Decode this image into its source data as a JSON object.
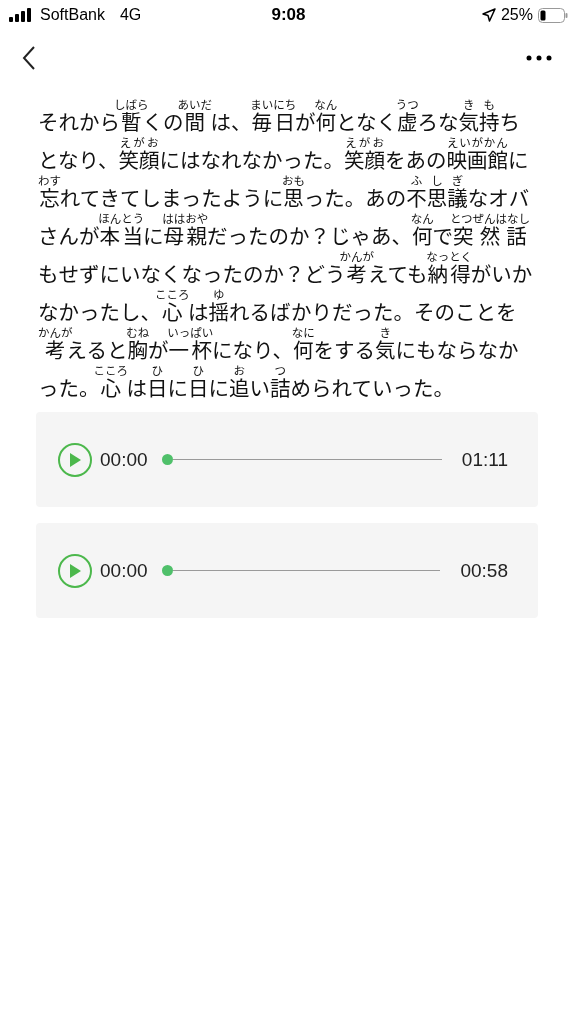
{
  "status_bar": {
    "carrier": "SoftBank",
    "network": "4G",
    "time": "9:08",
    "battery": "25%"
  },
  "passage": [
    {
      "text": "それから"
    },
    {
      "text": "暫",
      "ruby": "しばら"
    },
    {
      "text": "くの"
    },
    {
      "text": "間",
      "ruby": "あいだ"
    },
    {
      "text": " は、"
    },
    {
      "text": "毎日",
      "ruby": "まいにち"
    },
    {
      "text": "が"
    },
    {
      "text": "何",
      "ruby": "なん"
    },
    {
      "text": "となく"
    },
    {
      "text": "虚",
      "ruby": "うつ"
    },
    {
      "text": "ろな"
    },
    {
      "text": "気持",
      "ruby": "きも"
    },
    {
      "text": "ちとなり、"
    },
    {
      "text": "笑顔",
      "ruby": "えがお"
    },
    {
      "text": "にはなれなかった。"
    },
    {
      "text": "笑顔",
      "ruby": "えがお"
    },
    {
      "text": "をあの"
    },
    {
      "text": "映画館",
      "ruby": "えいがかん"
    },
    {
      "text": "に"
    },
    {
      "text": "忘",
      "ruby": "わす"
    },
    {
      "text": "れてきてしまったように"
    },
    {
      "text": "思",
      "ruby": "おも"
    },
    {
      "text": "った。あの"
    },
    {
      "text": "不思議",
      "ruby": "ふしぎ"
    },
    {
      "text": "なオバさんが"
    },
    {
      "text": "本当",
      "ruby": "ほんとう"
    },
    {
      "text": "に"
    },
    {
      "text": "母親",
      "ruby": "ははおや"
    },
    {
      "text": "だったのか？じゃあ、"
    },
    {
      "text": "何",
      "ruby": "なん"
    },
    {
      "text": "で"
    },
    {
      "text": "突然話",
      "ruby": "とつぜんはなし"
    },
    {
      "text": " もせずにいなくなったのか？どう"
    },
    {
      "text": "考",
      "ruby": "かんが"
    },
    {
      "text": "えても"
    },
    {
      "text": "納得",
      "ruby": "なっとく"
    },
    {
      "text": "がいかなかったし、"
    },
    {
      "text": "心",
      "ruby": "こころ"
    },
    {
      "text": " は"
    },
    {
      "text": "揺",
      "ruby": "ゆ"
    },
    {
      "text": "れるばかりだった。そのことを"
    },
    {
      "text": "考",
      "ruby": "かんが"
    },
    {
      "text": "えると"
    },
    {
      "text": "胸",
      "ruby": "むね"
    },
    {
      "text": "が"
    },
    {
      "text": "一杯",
      "ruby": "いっぱい"
    },
    {
      "text": "になり、"
    },
    {
      "text": "何",
      "ruby": "なに"
    },
    {
      "text": "をする"
    },
    {
      "text": "気",
      "ruby": "き"
    },
    {
      "text": "にもならなかった。"
    },
    {
      "text": "心",
      "ruby": "こころ"
    },
    {
      "text": " は"
    },
    {
      "text": "日",
      "ruby": "ひ"
    },
    {
      "text": "に"
    },
    {
      "text": "日",
      "ruby": "ひ"
    },
    {
      "text": "に"
    },
    {
      "text": "追",
      "ruby": "お"
    },
    {
      "text": "い"
    },
    {
      "text": "詰",
      "ruby": "つ"
    },
    {
      "text": "められていった。"
    }
  ],
  "players": [
    {
      "current": "00:00",
      "duration": "01:11",
      "level": 0
    },
    {
      "current": "00:00",
      "duration": "00:58",
      "level": 0
    }
  ]
}
